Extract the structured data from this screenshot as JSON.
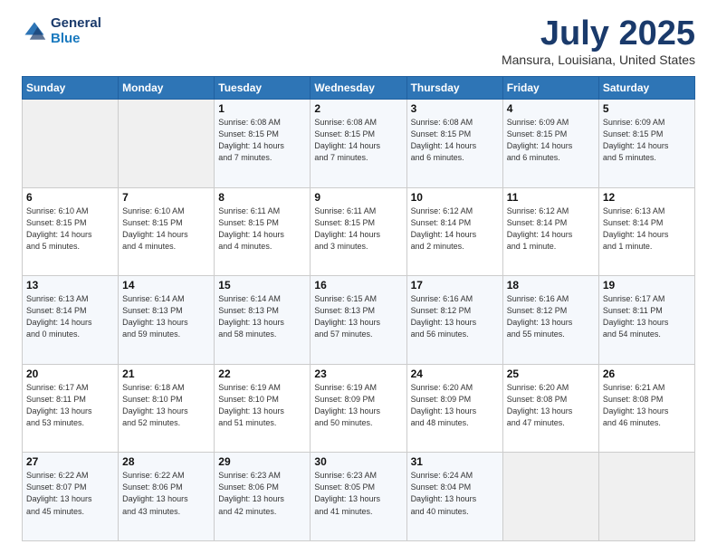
{
  "header": {
    "logo_line1": "General",
    "logo_line2": "Blue",
    "title": "July 2025",
    "subtitle": "Mansura, Louisiana, United States"
  },
  "weekdays": [
    "Sunday",
    "Monday",
    "Tuesday",
    "Wednesday",
    "Thursday",
    "Friday",
    "Saturday"
  ],
  "weeks": [
    [
      {
        "day": "",
        "info": ""
      },
      {
        "day": "",
        "info": ""
      },
      {
        "day": "1",
        "info": "Sunrise: 6:08 AM\nSunset: 8:15 PM\nDaylight: 14 hours\nand 7 minutes."
      },
      {
        "day": "2",
        "info": "Sunrise: 6:08 AM\nSunset: 8:15 PM\nDaylight: 14 hours\nand 7 minutes."
      },
      {
        "day": "3",
        "info": "Sunrise: 6:08 AM\nSunset: 8:15 PM\nDaylight: 14 hours\nand 6 minutes."
      },
      {
        "day": "4",
        "info": "Sunrise: 6:09 AM\nSunset: 8:15 PM\nDaylight: 14 hours\nand 6 minutes."
      },
      {
        "day": "5",
        "info": "Sunrise: 6:09 AM\nSunset: 8:15 PM\nDaylight: 14 hours\nand 5 minutes."
      }
    ],
    [
      {
        "day": "6",
        "info": "Sunrise: 6:10 AM\nSunset: 8:15 PM\nDaylight: 14 hours\nand 5 minutes."
      },
      {
        "day": "7",
        "info": "Sunrise: 6:10 AM\nSunset: 8:15 PM\nDaylight: 14 hours\nand 4 minutes."
      },
      {
        "day": "8",
        "info": "Sunrise: 6:11 AM\nSunset: 8:15 PM\nDaylight: 14 hours\nand 4 minutes."
      },
      {
        "day": "9",
        "info": "Sunrise: 6:11 AM\nSunset: 8:15 PM\nDaylight: 14 hours\nand 3 minutes."
      },
      {
        "day": "10",
        "info": "Sunrise: 6:12 AM\nSunset: 8:14 PM\nDaylight: 14 hours\nand 2 minutes."
      },
      {
        "day": "11",
        "info": "Sunrise: 6:12 AM\nSunset: 8:14 PM\nDaylight: 14 hours\nand 1 minute."
      },
      {
        "day": "12",
        "info": "Sunrise: 6:13 AM\nSunset: 8:14 PM\nDaylight: 14 hours\nand 1 minute."
      }
    ],
    [
      {
        "day": "13",
        "info": "Sunrise: 6:13 AM\nSunset: 8:14 PM\nDaylight: 14 hours\nand 0 minutes."
      },
      {
        "day": "14",
        "info": "Sunrise: 6:14 AM\nSunset: 8:13 PM\nDaylight: 13 hours\nand 59 minutes."
      },
      {
        "day": "15",
        "info": "Sunrise: 6:14 AM\nSunset: 8:13 PM\nDaylight: 13 hours\nand 58 minutes."
      },
      {
        "day": "16",
        "info": "Sunrise: 6:15 AM\nSunset: 8:13 PM\nDaylight: 13 hours\nand 57 minutes."
      },
      {
        "day": "17",
        "info": "Sunrise: 6:16 AM\nSunset: 8:12 PM\nDaylight: 13 hours\nand 56 minutes."
      },
      {
        "day": "18",
        "info": "Sunrise: 6:16 AM\nSunset: 8:12 PM\nDaylight: 13 hours\nand 55 minutes."
      },
      {
        "day": "19",
        "info": "Sunrise: 6:17 AM\nSunset: 8:11 PM\nDaylight: 13 hours\nand 54 minutes."
      }
    ],
    [
      {
        "day": "20",
        "info": "Sunrise: 6:17 AM\nSunset: 8:11 PM\nDaylight: 13 hours\nand 53 minutes."
      },
      {
        "day": "21",
        "info": "Sunrise: 6:18 AM\nSunset: 8:10 PM\nDaylight: 13 hours\nand 52 minutes."
      },
      {
        "day": "22",
        "info": "Sunrise: 6:19 AM\nSunset: 8:10 PM\nDaylight: 13 hours\nand 51 minutes."
      },
      {
        "day": "23",
        "info": "Sunrise: 6:19 AM\nSunset: 8:09 PM\nDaylight: 13 hours\nand 50 minutes."
      },
      {
        "day": "24",
        "info": "Sunrise: 6:20 AM\nSunset: 8:09 PM\nDaylight: 13 hours\nand 48 minutes."
      },
      {
        "day": "25",
        "info": "Sunrise: 6:20 AM\nSunset: 8:08 PM\nDaylight: 13 hours\nand 47 minutes."
      },
      {
        "day": "26",
        "info": "Sunrise: 6:21 AM\nSunset: 8:08 PM\nDaylight: 13 hours\nand 46 minutes."
      }
    ],
    [
      {
        "day": "27",
        "info": "Sunrise: 6:22 AM\nSunset: 8:07 PM\nDaylight: 13 hours\nand 45 minutes."
      },
      {
        "day": "28",
        "info": "Sunrise: 6:22 AM\nSunset: 8:06 PM\nDaylight: 13 hours\nand 43 minutes."
      },
      {
        "day": "29",
        "info": "Sunrise: 6:23 AM\nSunset: 8:06 PM\nDaylight: 13 hours\nand 42 minutes."
      },
      {
        "day": "30",
        "info": "Sunrise: 6:23 AM\nSunset: 8:05 PM\nDaylight: 13 hours\nand 41 minutes."
      },
      {
        "day": "31",
        "info": "Sunrise: 6:24 AM\nSunset: 8:04 PM\nDaylight: 13 hours\nand 40 minutes."
      },
      {
        "day": "",
        "info": ""
      },
      {
        "day": "",
        "info": ""
      }
    ]
  ]
}
